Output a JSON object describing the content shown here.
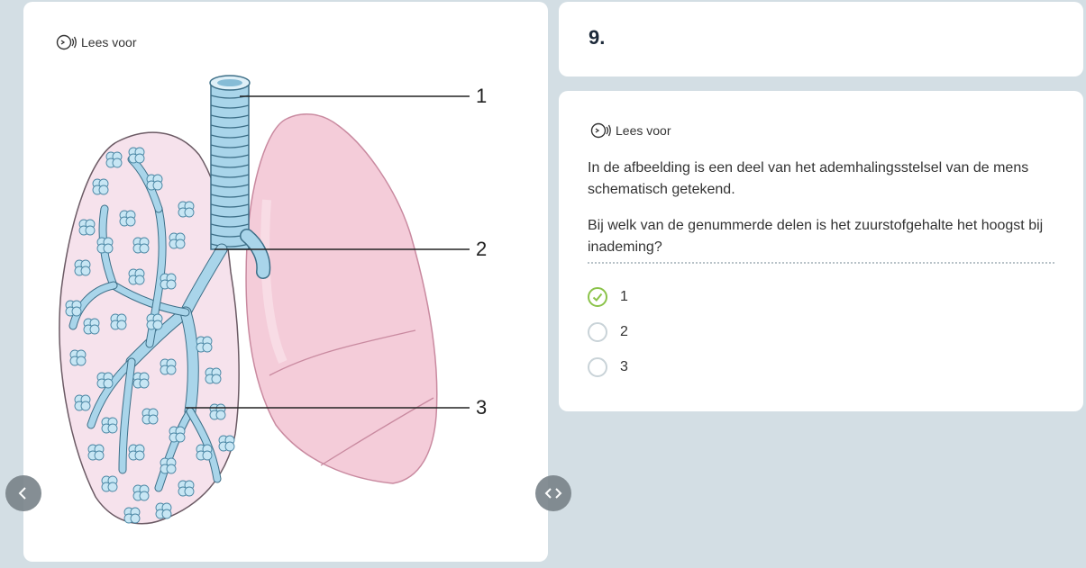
{
  "left_panel": {
    "read_aloud_label": "Lees voor",
    "figure_labels": [
      "1",
      "2",
      "3"
    ]
  },
  "question": {
    "number": "9.",
    "read_aloud_label": "Lees voor",
    "text_1": "In de afbeelding is een deel van het ademhalingsstelsel van de mens schematisch getekend.",
    "text_2": "Bij welk van de genummerde delen is het zuurstofgehalte het hoogst bij inademing?",
    "options": [
      {
        "label": "1",
        "selected": true
      },
      {
        "label": "2",
        "selected": false
      },
      {
        "label": "3",
        "selected": false
      }
    ]
  },
  "colors": {
    "background": "#d3dee4",
    "selected_green": "#8bc34a",
    "lung_pink": "#f3c9d6",
    "airway_blue": "#a9d5ea"
  },
  "icons": {
    "read_aloud": "speaker-icon",
    "prev": "chevron-left-icon",
    "next": "chevron-left-right-icon"
  }
}
